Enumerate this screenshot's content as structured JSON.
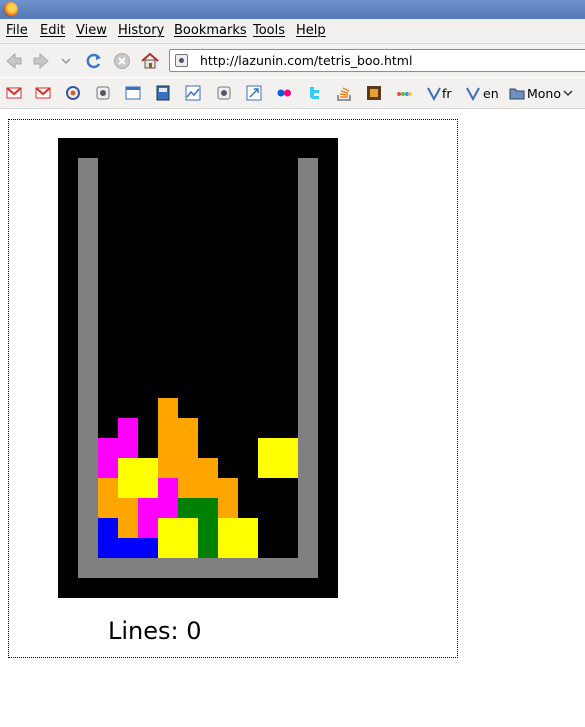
{
  "browser": {
    "menu": [
      "File",
      "Edit",
      "View",
      "History",
      "Bookmarks",
      "Tools",
      "Help"
    ],
    "url": "http://lazunin.com/tetris_boo.html",
    "bookmarks": {
      "fr_label": "fr",
      "en_label": "en",
      "folder_label": "Mono"
    }
  },
  "game": {
    "lines_label": "Lines: 0",
    "colors": {
      "wall": "#808080",
      "background": "#000000",
      "orange": "#ffa500",
      "magenta": "#ff00ff",
      "yellow": "#ffff00",
      "blue": "#0000ff",
      "green": "#008000"
    },
    "grid": {
      "columns": 10,
      "rows": 20,
      "stack": [
        {
          "row": 12,
          "cells": [
            [
              "3",
              "orange"
            ]
          ]
        },
        {
          "row": 13,
          "cells": [
            [
              "1",
              "magenta"
            ],
            [
              "3",
              "orange"
            ],
            [
              "4",
              "orange"
            ]
          ]
        },
        {
          "row": 14,
          "cells": [
            [
              "0",
              "magenta"
            ],
            [
              "1",
              "magenta"
            ],
            [
              "3",
              "orange"
            ],
            [
              "4",
              "orange"
            ],
            [
              "8",
              "yellow"
            ],
            [
              "9",
              "yellow"
            ]
          ]
        },
        {
          "row": 15,
          "cells": [
            [
              "0",
              "magenta"
            ],
            [
              "1",
              "yellow"
            ],
            [
              "2",
              "yellow"
            ],
            [
              "3",
              "orange"
            ],
            [
              "4",
              "orange"
            ],
            [
              "5",
              "orange"
            ],
            [
              "8",
              "yellow"
            ],
            [
              "9",
              "yellow"
            ]
          ]
        },
        {
          "row": 16,
          "cells": [
            [
              "0",
              "orange"
            ],
            [
              "1",
              "yellow"
            ],
            [
              "2",
              "yellow"
            ],
            [
              "3",
              "magenta"
            ],
            [
              "4",
              "orange"
            ],
            [
              "5",
              "orange"
            ],
            [
              "6",
              "orange"
            ]
          ]
        },
        {
          "row": 17,
          "cells": [
            [
              "0",
              "orange"
            ],
            [
              "1",
              "orange"
            ],
            [
              "2",
              "magenta"
            ],
            [
              "3",
              "magenta"
            ],
            [
              "4",
              "green"
            ],
            [
              "5",
              "green"
            ],
            [
              "6",
              "orange"
            ]
          ]
        },
        {
          "row": 18,
          "cells": [
            [
              "0",
              "blue"
            ],
            [
              "1",
              "orange"
            ],
            [
              "2",
              "magenta"
            ],
            [
              "3",
              "yellow"
            ],
            [
              "4",
              "yellow"
            ],
            [
              "5",
              "green"
            ],
            [
              "6",
              "yellow"
            ],
            [
              "7",
              "yellow"
            ]
          ]
        },
        {
          "row": 19,
          "cells": [
            [
              "0",
              "blue"
            ],
            [
              "1",
              "blue"
            ],
            [
              "2",
              "blue"
            ],
            [
              "3",
              "yellow"
            ],
            [
              "4",
              "yellow"
            ],
            [
              "5",
              "green"
            ],
            [
              "6",
              "yellow"
            ],
            [
              "7",
              "yellow"
            ]
          ]
        }
      ]
    }
  }
}
